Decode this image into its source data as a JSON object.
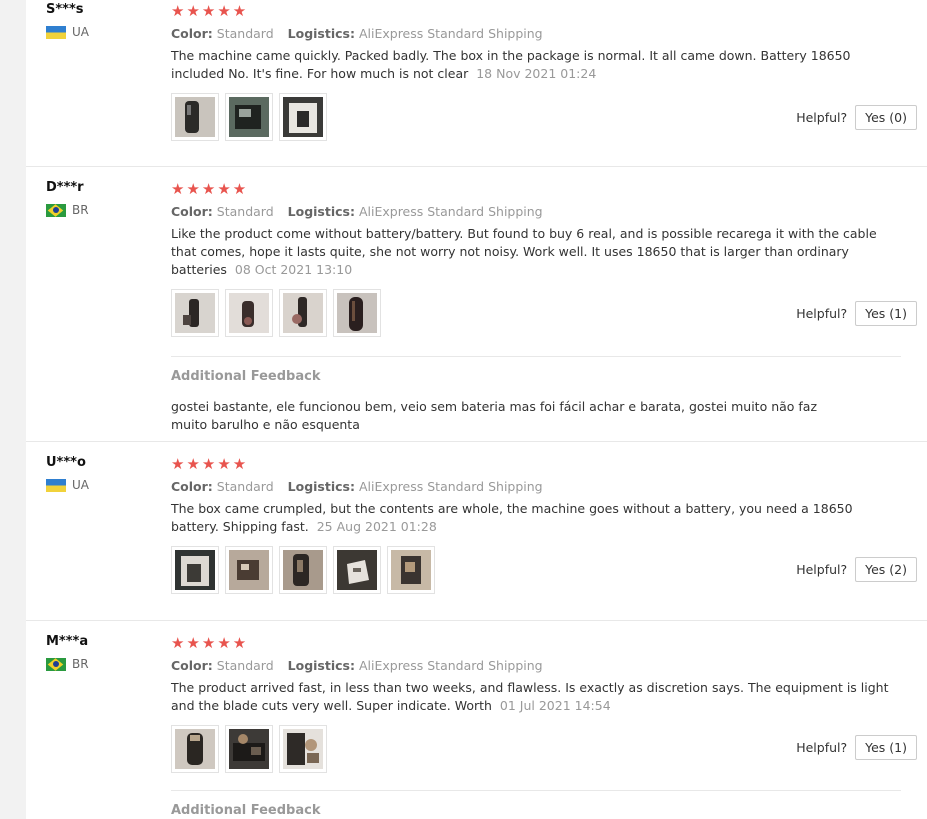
{
  "labels": {
    "color": "Color:",
    "logistics": "Logistics:",
    "helpful": "Helpful?",
    "additional_feedback": "Additional Feedback"
  },
  "reviews": [
    {
      "user": "S***s",
      "country": "UA",
      "stars": "★★★★★",
      "color": "Standard",
      "logistics": "AliExpress Standard Shipping",
      "text": "The machine came quickly. Packed badly. The box in the package is normal. It all came down. Battery 18650 included No. It's fine. For how much is not clear",
      "date": "18 Nov 2021 01:24",
      "yes": "Yes (0)"
    },
    {
      "user": "D***r",
      "country": "BR",
      "stars": "★★★★★",
      "color": "Standard",
      "logistics": "AliExpress Standard Shipping",
      "text": "Like the product come without battery/battery. But found to buy 6 real, and is possible recarega it with the cable that comes, hope it lasts quite, she not worry not noisy. Work well. It uses 18650 that is larger than ordinary batteries",
      "date": "08 Oct 2021 13:10",
      "yes": "Yes (1)",
      "additional": "gostei bastante, ele funcionou bem, veio sem bateria mas foi fácil achar e barata, gostei muito não faz muito barulho e não esquenta"
    },
    {
      "user": "U***o",
      "country": "UA",
      "stars": "★★★★★",
      "color": "Standard",
      "logistics": "AliExpress Standard Shipping",
      "text": "The box came crumpled, but the contents are whole, the machine goes without a battery, you need a 18650 battery. Shipping fast.",
      "date": "25 Aug 2021 01:28",
      "yes": "Yes (2)"
    },
    {
      "user": "M***a",
      "country": "BR",
      "stars": "★★★★★",
      "color": "Standard",
      "logistics": "AliExpress Standard Shipping",
      "text": "The product arrived fast, in less than two weeks, and flawless. Is exactly as discretion says. The equipment is light and the blade cuts very well. Super indicate. Worth",
      "date": "01 Jul 2021 14:54",
      "yes": "Yes (1)"
    }
  ]
}
